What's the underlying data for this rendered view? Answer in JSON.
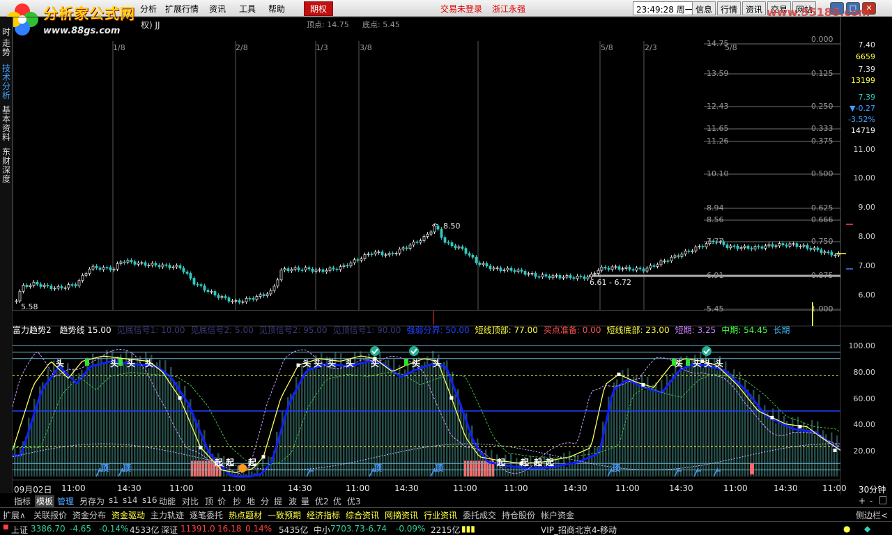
{
  "menu": {
    "items": [
      "分析",
      "扩展行情",
      "资讯",
      "工具",
      "帮助"
    ],
    "active_tab": "期权",
    "warning_login": "交易未登录",
    "warning_broker": "浙江永强",
    "clock": "23:49:28",
    "weekday": "周一",
    "right_buttons": [
      "信息",
      "行情",
      "资讯",
      "交易",
      "网站"
    ],
    "win_buttons": [
      "–",
      "□",
      "✕"
    ]
  },
  "logo": {
    "name": "分析家公式网",
    "url": "www.88gs.com",
    "watermark": "www.55188.com"
  },
  "left_tabs": [
    "时",
    "走势",
    "技术分析",
    "基本资料",
    "东财深度"
  ],
  "main_chart": {
    "title_suffix": "权) JJ",
    "top_point": "顶点: 14.75",
    "bottom_point": "底点: 5.45",
    "date_marks": [
      "1/8",
      "2/8",
      "1/3",
      "3/8",
      "5/8",
      "2/3",
      "5/8"
    ],
    "price_axis": [
      "7.40",
      "7.39",
      "7.39",
      "11.00",
      "10.00",
      "9.00",
      "8.00",
      "7.00",
      "6.00"
    ],
    "volume_labels": [
      "6659",
      "13199",
      "14719"
    ],
    "change": "▼-0.27",
    "change_pct": "-3.52%",
    "hi_label": "8.50",
    "lo_label": "5.58",
    "range_label": "6.61 - 6.72",
    "fib_left": [
      "14.75",
      "13.59",
      "12.43",
      "11.65",
      "11.26",
      "10.10",
      "8.94",
      "8.56",
      "7.77",
      "6.91",
      "5.45"
    ],
    "fib_right": [
      "0.000",
      "0.125",
      "0.250",
      "0.333",
      "0.375",
      "0.500",
      "0.625",
      "0.666",
      "0.750",
      "0.875",
      "1.000"
    ]
  },
  "indicator": {
    "name": "富力趋势2",
    "params": [
      {
        "label": "趋势线",
        "value": "15.00",
        "color": "#ffffff"
      },
      {
        "label": "见底信号1:",
        "value": "10.00",
        "color": "#3a3a7a"
      },
      {
        "label": "见底信号2:",
        "value": "5.00",
        "color": "#3a3a7a"
      },
      {
        "label": "见顶信号2:",
        "value": "95.00",
        "color": "#3a3a7a"
      },
      {
        "label": "见顶信号1:",
        "value": "90.00",
        "color": "#3a3a7a"
      },
      {
        "label": "强弱分界:",
        "value": "50.00",
        "color": "#2040ff"
      },
      {
        "label": "短线顶部:",
        "value": "77.00",
        "color": "#ffff40"
      },
      {
        "label": "买点准备:",
        "value": "0.00",
        "color": "#ff5050"
      },
      {
        "label": "短线底部:",
        "value": "23.00",
        "color": "#ffff40"
      },
      {
        "label": "短期:",
        "value": "3.25",
        "color": "#d080ff"
      },
      {
        "label": "中期:",
        "value": "54.45",
        "color": "#40ff40"
      },
      {
        "label": "长期",
        "value": "",
        "color": "#40c0ff"
      }
    ],
    "y_axis": [
      "100.00",
      "80.00",
      "60.00",
      "40.00",
      "20.00"
    ],
    "signals": {
      "top": "头",
      "start": "起",
      "bottom": "顶"
    }
  },
  "time_axis": {
    "labels": [
      "09月02日",
      "11:00",
      "14:30",
      "11:00",
      "11:00",
      "14:30",
      "11:00",
      "14:30",
      "11:00",
      "11:00",
      "14:30",
      "11:00",
      "14:30",
      "11:00",
      "14:30",
      "11:00"
    ],
    "period": "30分钟"
  },
  "tab_strip_1": [
    "指标",
    "模板",
    "管理",
    "另存为",
    "s1",
    "s14",
    "s16",
    "动能",
    "对比",
    "顶",
    "价",
    "抄",
    "地",
    "分",
    "提",
    "波",
    "量",
    "优2",
    "优",
    "优3"
  ],
  "tab_strip_2": [
    "扩展∧",
    "关联报价",
    "资金分布",
    "资金驱动",
    "主力轨迹",
    "逐笔委托",
    "热点题材",
    "一致预期",
    "经济指标",
    "综合资讯",
    "网摘资讯",
    "行业资讯",
    "委托成交",
    "持仓股份",
    "帐户资金"
  ],
  "tab_strip_2_right": "侧边栏<",
  "zoom_controls": [
    "+",
    "-"
  ],
  "status": {
    "sh_label": "上证",
    "sh_val": "3386.70",
    "sh_chg": "-4.65",
    "sh_pct": "-0.14%",
    "sh_amt": "4533亿",
    "sz_label": "深证",
    "sz_val": "11391.0",
    "sz_chg": "16.18",
    "sz_pct": "0.14%",
    "sz_amt": "5435亿",
    "zx_label": "中小",
    "zx_val": "7703.73",
    "zx_chg": "-6.74",
    "zx_pct": "-0.09%",
    "zx_amt": "2215亿",
    "server": "VIP_招商北京4-移动"
  },
  "colors": {
    "up": "#ff4040",
    "down": "#30d0c0",
    "axis": "#c0c0c0",
    "bg": "#000000"
  }
}
